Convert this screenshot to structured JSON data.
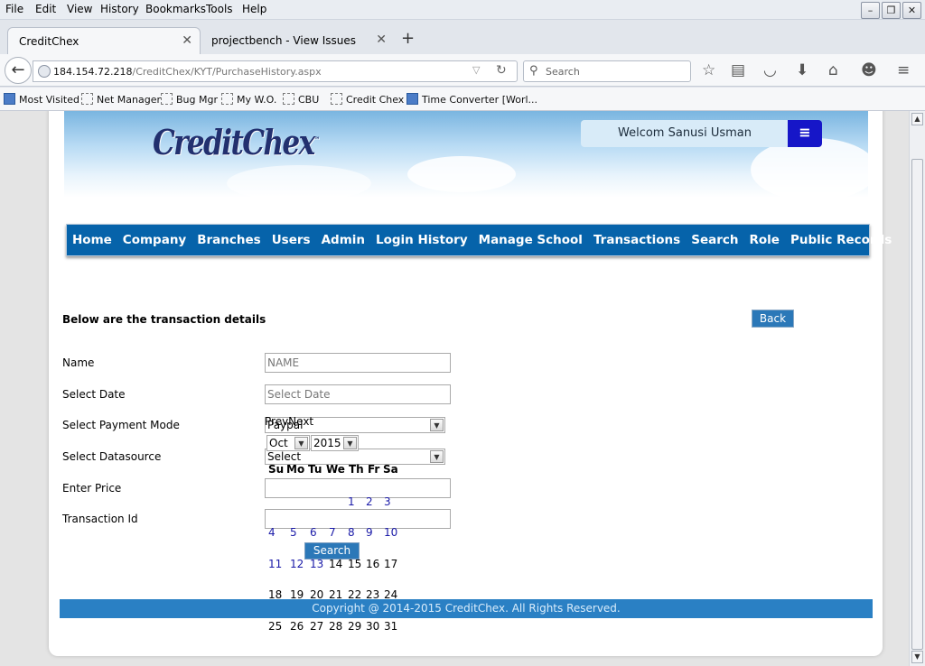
{
  "browser": {
    "menu": [
      "File",
      "Edit",
      "View",
      "History",
      "Bookmarks",
      "Tools",
      "Help"
    ],
    "tabs": [
      {
        "title": "CreditChex"
      },
      {
        "title": "projectbench - View Issues"
      }
    ],
    "url_host": "184.154.72.218",
    "url_path": "/CreditChex/KYT/PurchaseHistory.aspx",
    "search_placeholder": "Search",
    "bookmarks": [
      "Most Visited",
      "Net Manager",
      "Bug Mgr",
      "My W.O.",
      "CBU",
      "Credit Chex",
      "Time Converter [Worl..."
    ]
  },
  "header": {
    "logo_text": "CreditChex",
    "welcome_text": "Welcom Sanusi Usman"
  },
  "nav": [
    "Home",
    "Company",
    "Branches",
    "Users",
    "Admin",
    "Login History",
    "Manage School",
    "Transactions",
    "Search",
    "Role",
    "Public Records"
  ],
  "content": {
    "heading": "Below are the transaction details",
    "back_label": "Back"
  },
  "form": {
    "name_label": "Name",
    "name_placeholder": "NAME",
    "date_label": "Select Date",
    "date_placeholder": "Select Date",
    "payment_label": "Select Payment Mode",
    "payment_value": "Paypal",
    "datasource_label": "Select Datasource",
    "datasource_value": "Select",
    "price_label": "Enter Price",
    "txn_label": "Transaction Id",
    "search_label": "Search"
  },
  "calendar": {
    "prevnext": "PrevNext",
    "month": "Oct",
    "year": "2015",
    "weekdays": [
      "Su",
      "Mo",
      "Tu",
      "We",
      "Th",
      "Fr",
      "Sa"
    ],
    "weeks": [
      [
        "",
        "",
        "",
        "",
        "1",
        "2",
        "3"
      ],
      [
        "4",
        "5",
        "6",
        "7",
        "8",
        "9",
        "10"
      ],
      [
        "11",
        "12",
        "13",
        "14",
        "15",
        "16",
        "17"
      ],
      [
        "18",
        "19",
        "20",
        "21",
        "22",
        "23",
        "24"
      ],
      [
        "25",
        "26",
        "27",
        "28",
        "29",
        "30",
        "31"
      ]
    ]
  },
  "footer": {
    "copyright": "Copyright @ 2014-2015 CreditChex. All Rights Reserved."
  }
}
